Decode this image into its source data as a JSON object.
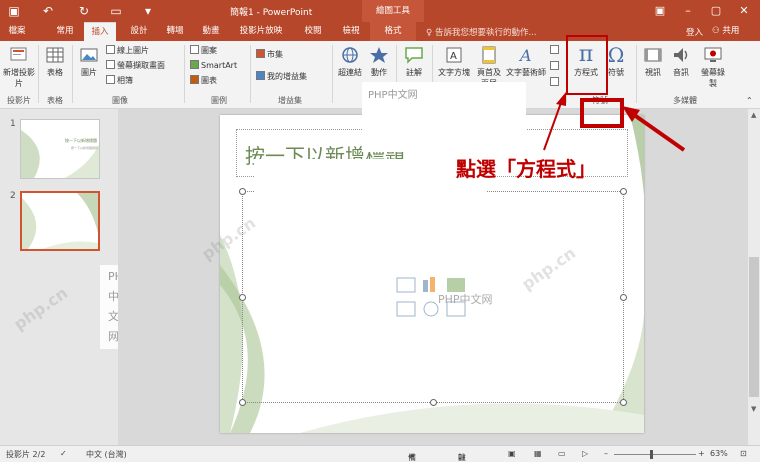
{
  "title_bar": {
    "doc_title": "簡報1 - PowerPoint",
    "contextual_group": "繪圖工具",
    "window_controls": [
      "minimize-icon",
      "maximize-icon",
      "close-icon"
    ]
  },
  "tabs": [
    {
      "label": "檔案"
    },
    {
      "label": "常用"
    },
    {
      "label": "插入"
    },
    {
      "label": "設計"
    },
    {
      "label": "轉場"
    },
    {
      "label": "動畫"
    },
    {
      "label": "投影片放映"
    },
    {
      "label": "校閱"
    },
    {
      "label": "檢視"
    },
    {
      "label": "格式"
    }
  ],
  "active_tab": "插入",
  "tell_me": "告訴我您想要執行的動作...",
  "sign_in": "登入",
  "share": "共用",
  "ribbon": {
    "new_slide": "新增投影片",
    "table": "表格",
    "pictures": "圖片",
    "online_pictures": "線上圖片",
    "screenshot": "螢幕擷取畫面",
    "album": "相簿",
    "shapes": "圖案",
    "smartart": "SmartArt",
    "chart": "圖表",
    "store": "市集",
    "my_addins": "我的增益集",
    "hyperlink": "超連結",
    "action": "動作",
    "comment": "註解",
    "textbox": "文字方塊",
    "header_footer": "頁首及頁尾",
    "wordart": "文字藝術師",
    "equation": "方程式",
    "symbol": "符號",
    "video": "視訊",
    "audio": "音訊",
    "screen_recording": "螢幕錄製",
    "groups": {
      "slides": "投影片",
      "tables": "表格",
      "images": "圖像",
      "illustrations": "圖例",
      "addins": "增益集",
      "symbols": "符號",
      "media": "多媒體"
    }
  },
  "thumbnails": [
    {
      "num": "1",
      "title": "按一下以新增標題",
      "subtitle": "按一下以新增副標題"
    },
    {
      "num": "2"
    }
  ],
  "slide": {
    "title_placeholder": "按一下以新增標題",
    "annotation": "點選「方程式」"
  },
  "watermarks": [
    "PHP中文网",
    "php.cn"
  ],
  "status": {
    "slide_num": "投影片 2/2",
    "language": "中文 (台灣)",
    "notes": "備忘稿",
    "comments": "註解",
    "zoom": "63%"
  },
  "colors": {
    "accent": "#b7472a",
    "annotation_red": "#c00000",
    "selected_thumb": "#d35230"
  }
}
